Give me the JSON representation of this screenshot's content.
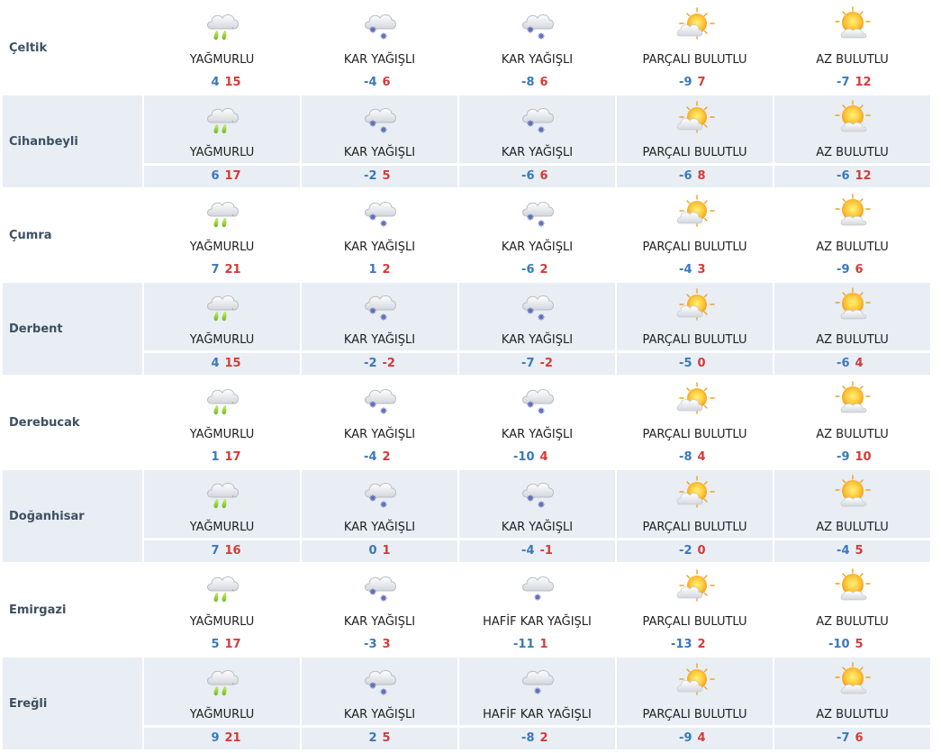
{
  "rows": [
    {
      "city": "Çeltik",
      "days": [
        {
          "cond": "YAĞMURLU",
          "icon": "rain-cloud-icon",
          "min": "4",
          "max": "15"
        },
        {
          "cond": "KAR YAĞIŞLI",
          "icon": "snow-cloud-icon",
          "min": "-4",
          "max": "6"
        },
        {
          "cond": "KAR YAĞIŞLI",
          "icon": "snow-cloud-icon",
          "min": "-8",
          "max": "6"
        },
        {
          "cond": "PARÇALI BULUTLU",
          "icon": "partly-cloudy-icon",
          "min": "-9",
          "max": "7"
        },
        {
          "cond": "AZ BULUTLU",
          "icon": "mostly-sunny-icon",
          "min": "-7",
          "max": "12"
        }
      ]
    },
    {
      "city": "Cihanbeyli",
      "days": [
        {
          "cond": "YAĞMURLU",
          "icon": "rain-cloud-icon",
          "min": "6",
          "max": "17"
        },
        {
          "cond": "KAR YAĞIŞLI",
          "icon": "snow-cloud-icon",
          "min": "-2",
          "max": "5"
        },
        {
          "cond": "KAR YAĞIŞLI",
          "icon": "snow-cloud-icon",
          "min": "-6",
          "max": "6"
        },
        {
          "cond": "PARÇALI BULUTLU",
          "icon": "partly-cloudy-icon",
          "min": "-6",
          "max": "8"
        },
        {
          "cond": "AZ BULUTLU",
          "icon": "mostly-sunny-icon",
          "min": "-6",
          "max": "12"
        }
      ]
    },
    {
      "city": "Çumra",
      "days": [
        {
          "cond": "YAĞMURLU",
          "icon": "rain-cloud-icon",
          "min": "7",
          "max": "21"
        },
        {
          "cond": "KAR YAĞIŞLI",
          "icon": "snow-cloud-icon",
          "min": "1",
          "max": "2"
        },
        {
          "cond": "KAR YAĞIŞLI",
          "icon": "snow-cloud-icon",
          "min": "-6",
          "max": "2"
        },
        {
          "cond": "PARÇALI BULUTLU",
          "icon": "partly-cloudy-icon",
          "min": "-4",
          "max": "3"
        },
        {
          "cond": "AZ BULUTLU",
          "icon": "mostly-sunny-icon",
          "min": "-9",
          "max": "6"
        }
      ]
    },
    {
      "city": "Derbent",
      "days": [
        {
          "cond": "YAĞMURLU",
          "icon": "rain-cloud-icon",
          "min": "4",
          "max": "15"
        },
        {
          "cond": "KAR YAĞIŞLI",
          "icon": "snow-cloud-icon",
          "min": "-2",
          "max": "-2"
        },
        {
          "cond": "KAR YAĞIŞLI",
          "icon": "snow-cloud-icon",
          "min": "-7",
          "max": "-2"
        },
        {
          "cond": "PARÇALI BULUTLU",
          "icon": "partly-cloudy-icon",
          "min": "-5",
          "max": "0"
        },
        {
          "cond": "AZ BULUTLU",
          "icon": "mostly-sunny-icon",
          "min": "-6",
          "max": "4"
        }
      ]
    },
    {
      "city": "Derebucak",
      "days": [
        {
          "cond": "YAĞMURLU",
          "icon": "rain-cloud-icon",
          "min": "1",
          "max": "17"
        },
        {
          "cond": "KAR YAĞIŞLI",
          "icon": "snow-cloud-icon",
          "min": "-4",
          "max": "2"
        },
        {
          "cond": "KAR YAĞIŞLI",
          "icon": "snow-cloud-icon",
          "min": "-10",
          "max": "4"
        },
        {
          "cond": "PARÇALI BULUTLU",
          "icon": "partly-cloudy-icon",
          "min": "-8",
          "max": "4"
        },
        {
          "cond": "AZ BULUTLU",
          "icon": "mostly-sunny-icon",
          "min": "-9",
          "max": "10"
        }
      ]
    },
    {
      "city": "Doğanhisar",
      "days": [
        {
          "cond": "YAĞMURLU",
          "icon": "rain-cloud-icon",
          "min": "7",
          "max": "16"
        },
        {
          "cond": "KAR YAĞIŞLI",
          "icon": "snow-cloud-icon",
          "min": "0",
          "max": "1"
        },
        {
          "cond": "KAR YAĞIŞLI",
          "icon": "snow-cloud-icon",
          "min": "-4",
          "max": "-1"
        },
        {
          "cond": "PARÇALI BULUTLU",
          "icon": "partly-cloudy-icon",
          "min": "-2",
          "max": "0"
        },
        {
          "cond": "AZ BULUTLU",
          "icon": "mostly-sunny-icon",
          "min": "-4",
          "max": "5"
        }
      ]
    },
    {
      "city": "Emirgazi",
      "days": [
        {
          "cond": "YAĞMURLU",
          "icon": "rain-cloud-icon",
          "min": "5",
          "max": "17"
        },
        {
          "cond": "KAR YAĞIŞLI",
          "icon": "snow-cloud-icon",
          "min": "-3",
          "max": "3"
        },
        {
          "cond": "HAFİF KAR YAĞIŞLI",
          "icon": "light-snow-cloud-icon",
          "min": "-11",
          "max": "1"
        },
        {
          "cond": "PARÇALI BULUTLU",
          "icon": "partly-cloudy-icon",
          "min": "-13",
          "max": "2"
        },
        {
          "cond": "AZ BULUTLU",
          "icon": "mostly-sunny-icon",
          "min": "-10",
          "max": "5"
        }
      ]
    },
    {
      "city": "Ereğli",
      "days": [
        {
          "cond": "YAĞMURLU",
          "icon": "rain-cloud-icon",
          "min": "9",
          "max": "21"
        },
        {
          "cond": "KAR YAĞIŞLI",
          "icon": "snow-cloud-icon",
          "min": "2",
          "max": "5"
        },
        {
          "cond": "HAFİF KAR YAĞIŞLI",
          "icon": "light-snow-cloud-icon",
          "min": "-8",
          "max": "2"
        },
        {
          "cond": "PARÇALI BULUTLU",
          "icon": "partly-cloudy-icon",
          "min": "-9",
          "max": "4"
        },
        {
          "cond": "AZ BULUTLU",
          "icon": "mostly-sunny-icon",
          "min": "-7",
          "max": "6"
        }
      ]
    }
  ]
}
